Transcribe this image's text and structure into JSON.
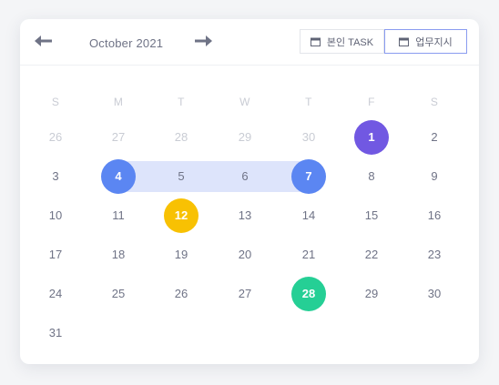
{
  "calendar": {
    "month_label": "October 2021",
    "tabs": [
      {
        "label": "본인 TASK",
        "icon": "calendar-icon",
        "active": false
      },
      {
        "label": "업무지시",
        "icon": "calendar-icon",
        "active": true
      }
    ],
    "weekdays": [
      "S",
      "M",
      "T",
      "W",
      "T",
      "F",
      "S"
    ],
    "weeks": [
      [
        {
          "d": "26",
          "muted": true
        },
        {
          "d": "27",
          "muted": true
        },
        {
          "d": "28",
          "muted": true
        },
        {
          "d": "29",
          "muted": true
        },
        {
          "d": "30",
          "muted": true
        },
        {
          "d": "1",
          "hl": "purple"
        },
        {
          "d": "2"
        }
      ],
      [
        {
          "d": "3"
        },
        {
          "d": "4",
          "hl": "blue",
          "range": "start"
        },
        {
          "d": "5",
          "range": "mid"
        },
        {
          "d": "6",
          "range": "mid"
        },
        {
          "d": "7",
          "hl": "blue",
          "range": "end"
        },
        {
          "d": "8"
        },
        {
          "d": "9"
        }
      ],
      [
        {
          "d": "10"
        },
        {
          "d": "11"
        },
        {
          "d": "12",
          "hl": "yellow"
        },
        {
          "d": "13"
        },
        {
          "d": "14"
        },
        {
          "d": "15"
        },
        {
          "d": "16"
        }
      ],
      [
        {
          "d": "17"
        },
        {
          "d": "18"
        },
        {
          "d": "19"
        },
        {
          "d": "20"
        },
        {
          "d": "21"
        },
        {
          "d": "22"
        },
        {
          "d": "23"
        }
      ],
      [
        {
          "d": "24"
        },
        {
          "d": "25"
        },
        {
          "d": "26"
        },
        {
          "d": "27"
        },
        {
          "d": "28",
          "hl": "green"
        },
        {
          "d": "29"
        },
        {
          "d": "30"
        }
      ],
      [
        {
          "d": "31"
        }
      ]
    ],
    "colors": {
      "purple": "#7158e2",
      "blue": "#5b86f2",
      "yellow": "#f8c103",
      "green": "#25cf95",
      "range": "#dde4fb"
    }
  }
}
